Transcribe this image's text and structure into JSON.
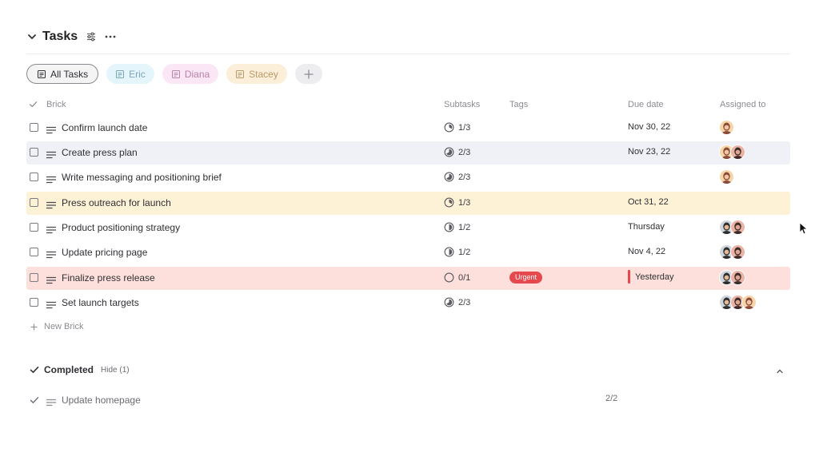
{
  "header": {
    "title": "Tasks"
  },
  "filters": [
    {
      "label": "All Tasks",
      "active": true,
      "bg": "#f4f4f5",
      "fg": "#2f2f33"
    },
    {
      "label": "Eric",
      "active": false,
      "bg": "#e4f6fb",
      "fg": "#7aa6b6"
    },
    {
      "label": "Diana",
      "active": false,
      "bg": "#fbe6f6",
      "fg": "#b684a8"
    },
    {
      "label": "Stacey",
      "active": false,
      "bg": "#fcefd9",
      "fg": "#b99a6a"
    }
  ],
  "columns": {
    "brick": "Brick",
    "subtasks": "Subtasks",
    "tags": "Tags",
    "due": "Due date",
    "assigned": "Assigned to"
  },
  "tasks": [
    {
      "name": "Confirm launch date",
      "subtasks": "1/3",
      "progress": 0.333,
      "tag": "",
      "due": "Nov 30, 22",
      "assignees": [
        "a"
      ],
      "highlight": ""
    },
    {
      "name": "Create press plan",
      "subtasks": "2/3",
      "progress": 0.667,
      "tag": "",
      "due": "Nov 23, 22",
      "assignees": [
        "a",
        "b"
      ],
      "highlight": "#f0f1f6"
    },
    {
      "name": "Write messaging and positioning brief",
      "subtasks": "2/3",
      "progress": 0.667,
      "tag": "",
      "due": "",
      "assignees": [
        "a"
      ],
      "highlight": ""
    },
    {
      "name": "Press outreach for launch",
      "subtasks": "1/3",
      "progress": 0.333,
      "tag": "",
      "due": "Oct 31, 22",
      "assignees": [],
      "highlight": "#fdf1d6"
    },
    {
      "name": "Product positioning strategy",
      "subtasks": "1/2",
      "progress": 0.5,
      "tag": "",
      "due": "Thursday",
      "assignees": [
        "c",
        "b"
      ],
      "highlight": ""
    },
    {
      "name": "Update pricing page",
      "subtasks": "1/2",
      "progress": 0.5,
      "tag": "",
      "due": "Nov 4, 22",
      "assignees": [
        "c",
        "b"
      ],
      "highlight": ""
    },
    {
      "name": "Finalize press release",
      "subtasks": "0/1",
      "progress": 0,
      "tag": "Urgent",
      "due": "Yesterday",
      "overdue": true,
      "assignees": [
        "c",
        "b"
      ],
      "highlight": "#fde0dc"
    },
    {
      "name": "Set launch targets",
      "subtasks": "2/3",
      "progress": 0.667,
      "tag": "",
      "due": "",
      "assignees": [
        "c",
        "b",
        "a"
      ],
      "highlight": ""
    }
  ],
  "new_brick": "New Brick",
  "completed": {
    "label": "Completed",
    "hide_label": "Hide (1)",
    "items": [
      {
        "name": "Update homepage",
        "subtasks": "2/2",
        "progress": 1
      }
    ]
  },
  "colors": {
    "urgent": "#e5484d",
    "border": "#ececee",
    "muted": "#8b8b92"
  }
}
